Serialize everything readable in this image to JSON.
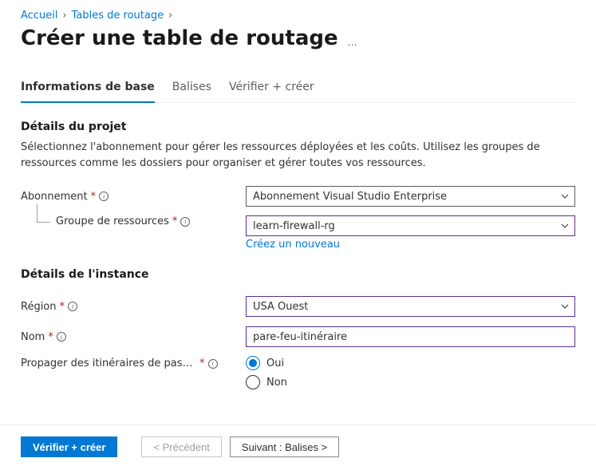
{
  "breadcrumb": {
    "home": "Accueil",
    "routeTables": "Tables de routage"
  },
  "page": {
    "title": "Créer une table de routage",
    "more": "…"
  },
  "tabs": {
    "basics": "Informations de base",
    "tags": "Balises",
    "review": "Vérifier + créer"
  },
  "project": {
    "heading": "Détails du projet",
    "description": "Sélectionnez l'abonnement pour gérer les ressources déployées et les coûts. Utilisez les groupes de ressources comme les dossiers pour organiser et gérer toutes vos ressources.",
    "subscriptionLabel": "Abonnement",
    "subscriptionValue": "Abonnement Visual Studio Enterprise",
    "resourceGroupLabel": "Groupe de ressources",
    "resourceGroupValue": "learn-firewall-rg",
    "createNew": "Créez un nouveau"
  },
  "instance": {
    "heading": "Détails de l'instance",
    "regionLabel": "Région",
    "regionValue": "USA Ouest",
    "nameLabel": "Nom",
    "nameValue": "pare-feu-itinéraire",
    "propagateLabel": "Propager des itinéraires de passerelle",
    "options": {
      "yes": "Oui",
      "no": "Non"
    }
  },
  "footer": {
    "review": "Vérifier + créer",
    "previous": "< Précédent",
    "next": "Suivant : Balises >"
  }
}
